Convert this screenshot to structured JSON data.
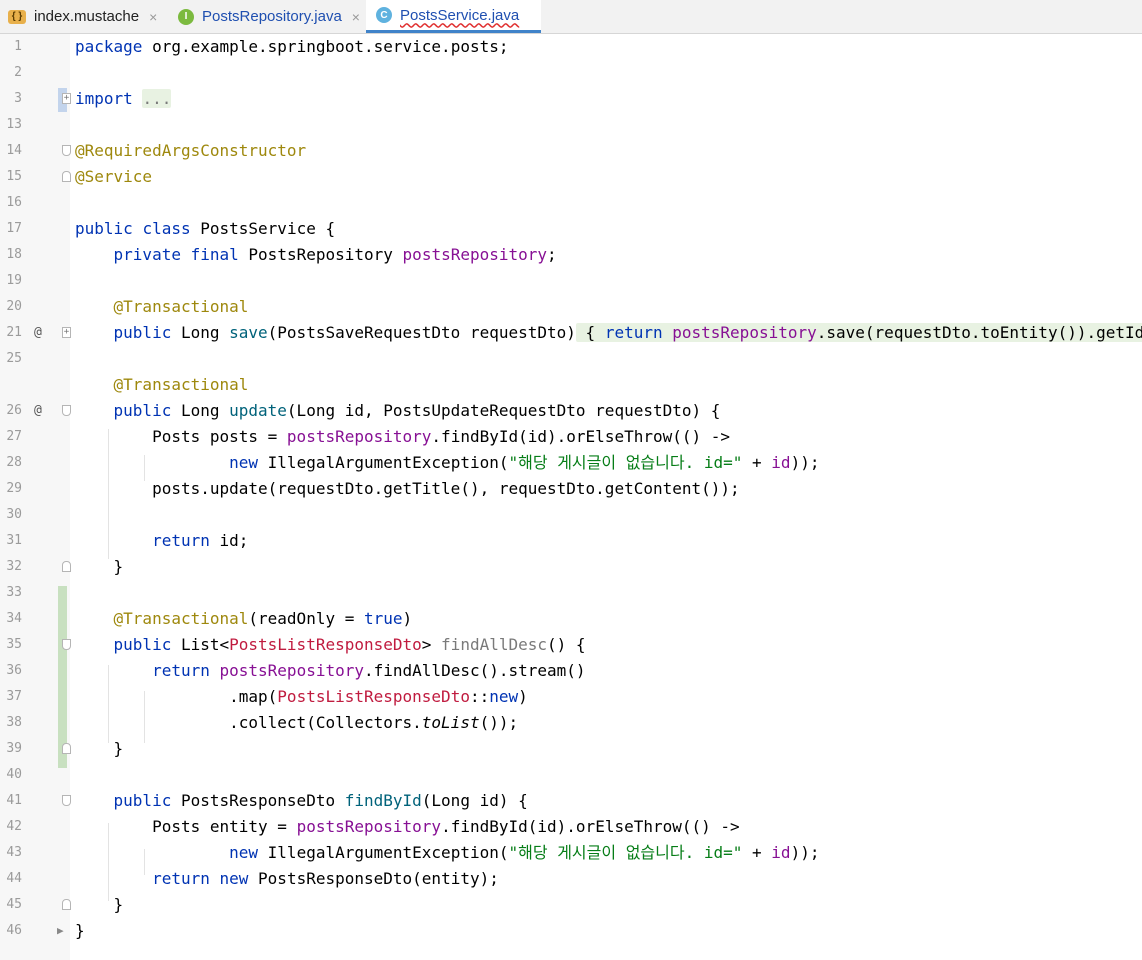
{
  "tabs": [
    {
      "label": "index.mustache",
      "close": "×",
      "icon": "mustache-file-icon"
    },
    {
      "label": "PostsRepository.java",
      "close": "×",
      "icon": "interface-icon",
      "badge": "I"
    },
    {
      "label": "PostsService.java",
      "icon": "class-icon",
      "badge": "C",
      "active": true
    }
  ],
  "gutter": {
    "override_marker": "@",
    "fold_collapsed": "+",
    "fold_expanded": "−",
    "run_marker": "▶"
  },
  "lines": {
    "1": "1",
    "2": "2",
    "3": "3",
    "13": "13",
    "14": "14",
    "15": "15",
    "16": "16",
    "17": "17",
    "18": "18",
    "19": "19",
    "20": "20",
    "21": "21",
    "25": "25",
    "26": "26",
    "27": "27",
    "28": "28",
    "29": "29",
    "30": "30",
    "31": "31",
    "32": "32",
    "33": "33",
    "34": "34",
    "35": "35",
    "36": "36",
    "37": "37",
    "38": "38",
    "39": "39",
    "40": "40",
    "41": "41",
    "42": "42",
    "43": "43",
    "44": "44",
    "45": "45",
    "46": "46"
  },
  "code": {
    "package_kw": "package",
    "package_name": " org.example.springboot.service.posts;",
    "import_kw": "import",
    "import_dots": "...",
    "ann_required": "@RequiredArgsConstructor",
    "ann_service": "@Service",
    "public": "public",
    "class": "class",
    "class_decl": " PostsService {",
    "private": "private",
    "final": "final",
    "repo_type": " PostsRepository ",
    "repo_field": "postsRepository",
    "semi": ";",
    "ann_tx": "@Transactional",
    "long_type": " Long ",
    "save_fn": "save",
    "save_params": "(PostsSaveRequestDto requestDto)",
    "brace_open": " { ",
    "return": "return",
    "save_body": ".save(requestDto.toEntity()).getId();",
    "brace_close": " }",
    "update_fn": "update",
    "update_params": "(Long id, PostsUpdateRequestDto requestDto) {",
    "posts_decl": "Posts posts = ",
    "find_by_id": ".findById(id).orElseThrow(() ->",
    "new": "new",
    "iae": " IllegalArgumentException(",
    "err_msg": "\"해당 게시글이 없습니다. id=\"",
    "plus_id": " + ",
    "id_var": "id",
    "close_paren": "));",
    "posts_update": "posts.update(requestDto.getTitle(), requestDto.getContent());",
    "return_id": " id;",
    "close_brace": "}",
    "ro_params_a": "(readOnly = ",
    "true": "true",
    "ro_params_b": ")",
    "list_a": " List<",
    "list_dto": "PostsListResponseDto",
    "list_b": "> ",
    "find_all_fn": "findAllDesc",
    "find_all_b": "() {",
    "stream": ".findAllDesc().stream()",
    "map_a": ".map(",
    "map_b": "::",
    "map_new": "new",
    "map_c": ")",
    "collect_a": ".collect(Collectors.",
    "to_list": "toList",
    "collect_b": "());",
    "resp_type": " PostsResponseDto ",
    "find_by_id_fn": "findById",
    "find_by_id_params": "(Long id) {",
    "entity_decl": "Posts entity = ",
    "return_new_b": " PostsResponseDto(entity);"
  }
}
